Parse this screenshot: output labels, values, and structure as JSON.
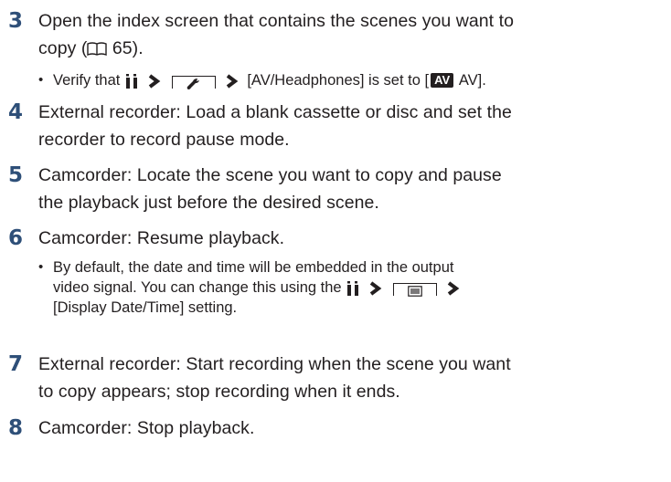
{
  "steps": [
    {
      "number": "3",
      "lines": [
        "Open the index screen that contains the scenes you want to",
        "copy (",
        " 65)."
      ]
    },
    {
      "number": "4",
      "lines": [
        "External recorder: Load a blank cassette or disc and set the",
        "recorder to record pause mode."
      ]
    },
    {
      "number": "5",
      "lines": [
        "Camcorder: Locate the scene you want to copy and pause",
        "the playback just before the desired scene."
      ]
    },
    {
      "number": "6",
      "lines": [
        "Camcorder: Resume playback."
      ]
    },
    {
      "number": "7",
      "lines": [
        "External recorder: Start recording when the scene you want",
        "to copy appears; stop recording when it ends."
      ]
    },
    {
      "number": "8",
      "lines": [
        "Camcorder: Stop playback."
      ]
    }
  ],
  "notes": {
    "step3_bullet": {
      "prefix": "Verify that ",
      "setting": " [AV/Headphones] is set to [",
      "badge": "AV",
      "suffix": " AV]."
    },
    "step6_bullet": {
      "line1": "By default, the date and time will be embedded in the output",
      "line2_prefix": "video signal. You can change this using the ",
      "line3": "[Display Date/Time] setting."
    }
  },
  "icons": [
    "menu-icon",
    "arrow-icon",
    "setup-wrench-icon",
    "book-icon",
    "playback-settings-icon"
  ],
  "colors": {
    "step_number": "#2e4f78",
    "text": "#231f20"
  }
}
